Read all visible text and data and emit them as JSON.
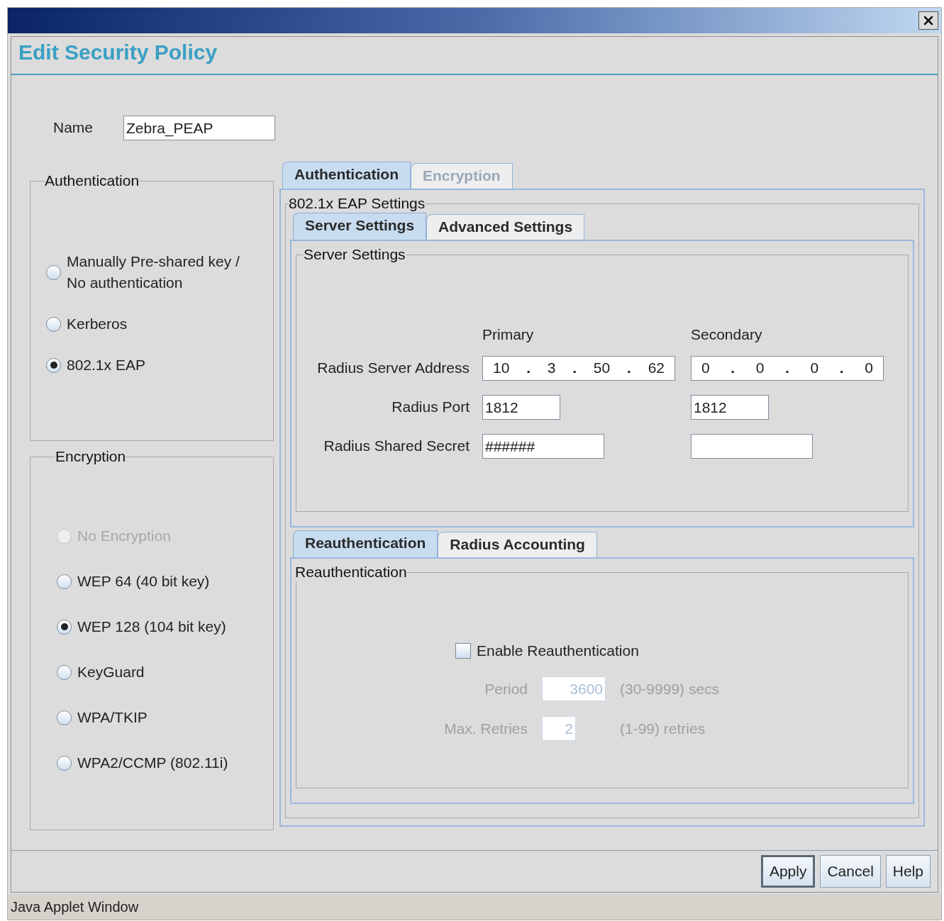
{
  "window": {
    "heading": "Edit Security Policy"
  },
  "name_field": {
    "label": "Name",
    "value": "Zebra_PEAP"
  },
  "authentication": {
    "title": "Authentication",
    "options": [
      {
        "label": "Manually Pre-shared key /\nNo authentication",
        "selected": false,
        "disabled": false
      },
      {
        "label": "Kerberos",
        "selected": false,
        "disabled": false
      },
      {
        "label": "802.1x EAP",
        "selected": true,
        "disabled": false
      }
    ]
  },
  "encryption": {
    "title": "Encryption",
    "options": [
      {
        "label": "No Encryption",
        "selected": false,
        "disabled": true
      },
      {
        "label": "WEP 64 (40 bit key)",
        "selected": false,
        "disabled": false
      },
      {
        "label": "WEP 128 (104 bit key)",
        "selected": true,
        "disabled": false
      },
      {
        "label": "KeyGuard",
        "selected": false,
        "disabled": false
      },
      {
        "label": "WPA/TKIP",
        "selected": false,
        "disabled": false
      },
      {
        "label": "WPA2/CCMP (802.11i)",
        "selected": false,
        "disabled": false
      }
    ]
  },
  "outer_tabs": [
    {
      "label": "Authentication",
      "selected": true,
      "disabled": false
    },
    {
      "label": "Encryption",
      "selected": false,
      "disabled": true
    }
  ],
  "eap_settings": {
    "title": "802.1x EAP Settings",
    "server_tabs": [
      {
        "label": "Server Settings",
        "selected": true
      },
      {
        "label": "Advanced Settings",
        "selected": false
      }
    ],
    "server_settings": {
      "title": "Server Settings",
      "columns": [
        "Primary",
        "Secondary"
      ],
      "address": {
        "label": "Radius Server Address",
        "separator": ".",
        "primary": [
          "10",
          "3",
          "50",
          "62"
        ],
        "secondary": [
          "0",
          "0",
          "0",
          "0"
        ]
      },
      "port": {
        "label": "Radius Port",
        "primary": "1812",
        "secondary": "1812"
      },
      "secret": {
        "label": "Radius Shared Secret",
        "primary": "######"
      }
    },
    "reauth_tabs": [
      {
        "label": "Reauthentication",
        "selected": true
      },
      {
        "label": "Radius Accounting",
        "selected": false
      }
    ],
    "reauthentication": {
      "title": "Reauthentication",
      "enable": {
        "label": "Enable Reauthentication",
        "checked": false
      },
      "fields": [
        {
          "label": "Period",
          "value": "3600",
          "range": "(30-9999) secs",
          "disabled": true
        },
        {
          "label": "Max. Retries",
          "value": "2",
          "range": "(1-99) retries",
          "disabled": true
        }
      ]
    }
  },
  "buttons": [
    {
      "label": "Apply",
      "default": true
    },
    {
      "label": "Cancel",
      "default": false
    },
    {
      "label": "Help",
      "default": false
    }
  ],
  "status_bar": "Java Applet Window"
}
